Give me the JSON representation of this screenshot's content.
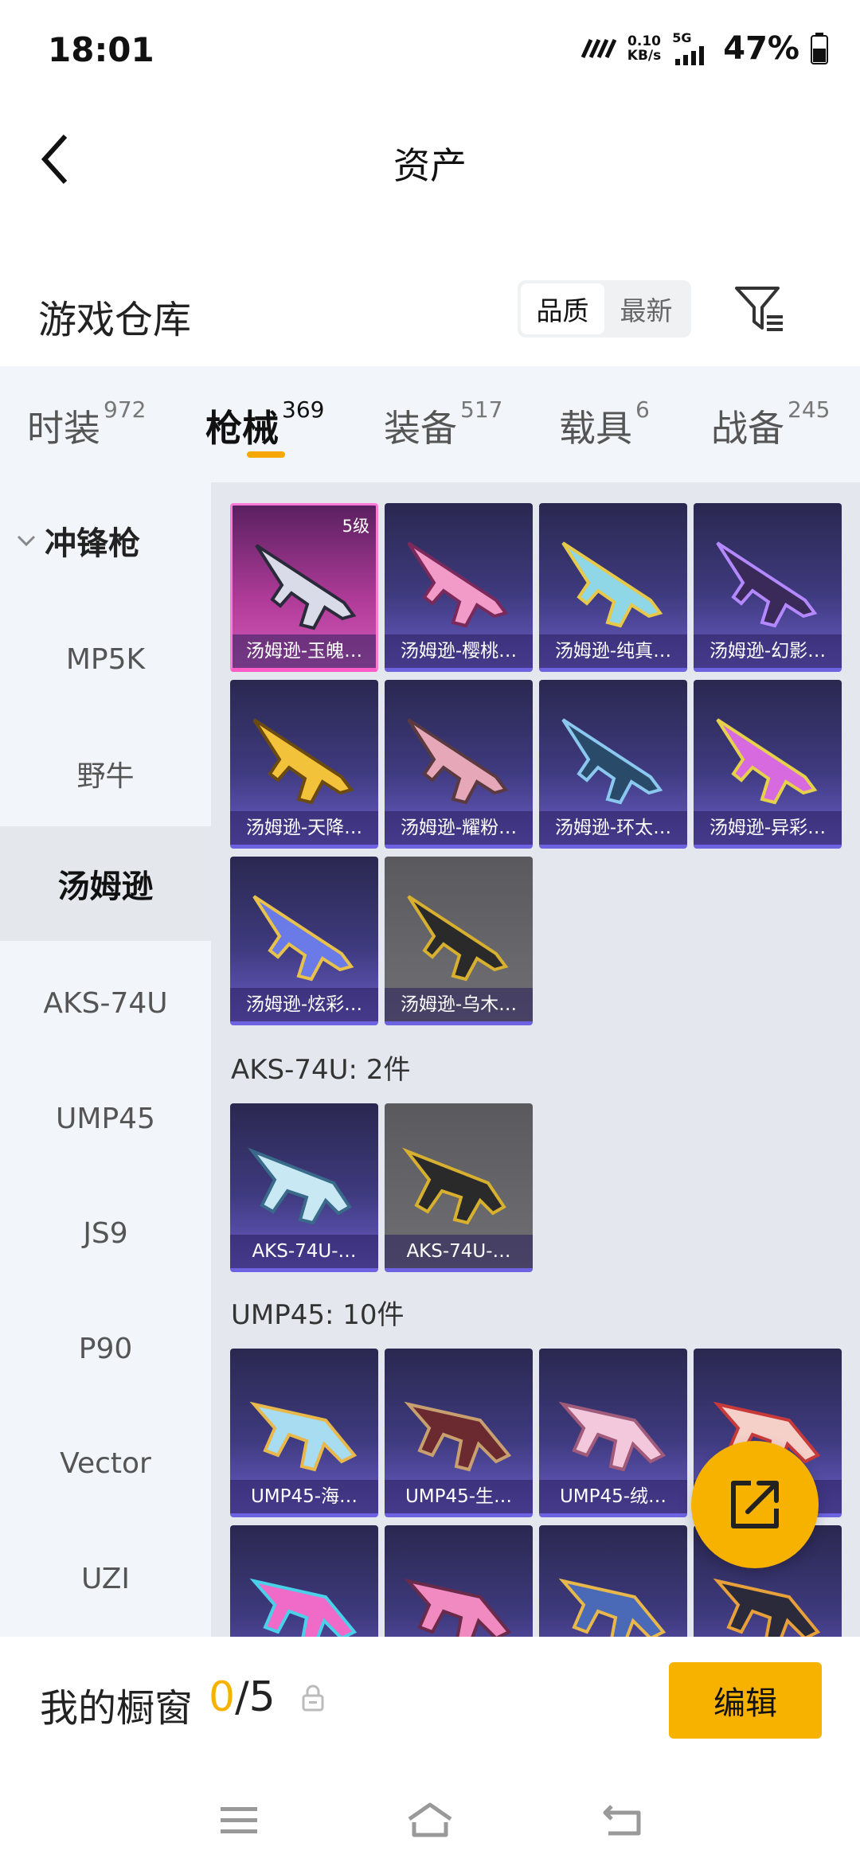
{
  "status_bar": {
    "time": "18:01",
    "speed_value": "0.10",
    "speed_unit": "KB/s",
    "network": "5G",
    "battery": "47%"
  },
  "header": {
    "title": "资产"
  },
  "warehouse": {
    "title": "游戏仓库",
    "sort_options": [
      "品质",
      "最新"
    ],
    "active_sort": "品质"
  },
  "category_tabs": [
    {
      "name": "时装",
      "count": "972"
    },
    {
      "name": "枪械",
      "count": "369"
    },
    {
      "name": "装备",
      "count": "517"
    },
    {
      "name": "载具",
      "count": "6"
    },
    {
      "name": "战备",
      "count": "245"
    }
  ],
  "sidebar": {
    "group": "冲锋枪",
    "items": [
      "MP5K",
      "野牛",
      "汤姆逊",
      "AKS-74U",
      "UMP45",
      "JS9",
      "P90",
      "Vector",
      "UZI"
    ],
    "active": "汤姆逊"
  },
  "sections": {
    "thompson": {
      "items": [
        {
          "label": "汤姆逊-玉魄…",
          "level": "5级",
          "rarity": "pink"
        },
        {
          "label": "汤姆逊-樱桃…",
          "rarity": "purple"
        },
        {
          "label": "汤姆逊-纯真…",
          "rarity": "purple"
        },
        {
          "label": "汤姆逊-幻影…",
          "rarity": "purple"
        },
        {
          "label": "汤姆逊-天降…",
          "rarity": "purple"
        },
        {
          "label": "汤姆逊-耀粉…",
          "rarity": "purple"
        },
        {
          "label": "汤姆逊-环太…",
          "rarity": "purple"
        },
        {
          "label": "汤姆逊-异彩…",
          "rarity": "purple"
        },
        {
          "label": "汤姆逊-炫彩…",
          "rarity": "purple"
        },
        {
          "label": "汤姆逊-乌木…",
          "rarity": "gray"
        }
      ]
    },
    "aks": {
      "title": "AKS-74U: 2件",
      "items": [
        {
          "label": "AKS-74U-…",
          "rarity": "purple"
        },
        {
          "label": "AKS-74U-…",
          "rarity": "gray"
        }
      ]
    },
    "ump": {
      "title": "UMP45: 10件",
      "items": [
        {
          "label": "UMP45-海…",
          "rarity": "purple"
        },
        {
          "label": "UMP45-生…",
          "rarity": "purple"
        },
        {
          "label": "UMP45-绒…",
          "rarity": "purple"
        },
        {
          "label": "",
          "rarity": "purple"
        }
      ]
    }
  },
  "showcase": {
    "label": "我的橱窗",
    "used": "0",
    "total": "/5",
    "edit_label": "编辑"
  },
  "colors": {
    "accent": "#f7b200",
    "rarity_purple": "#6d63e0",
    "rarity_pink": "#ff5cc8"
  }
}
